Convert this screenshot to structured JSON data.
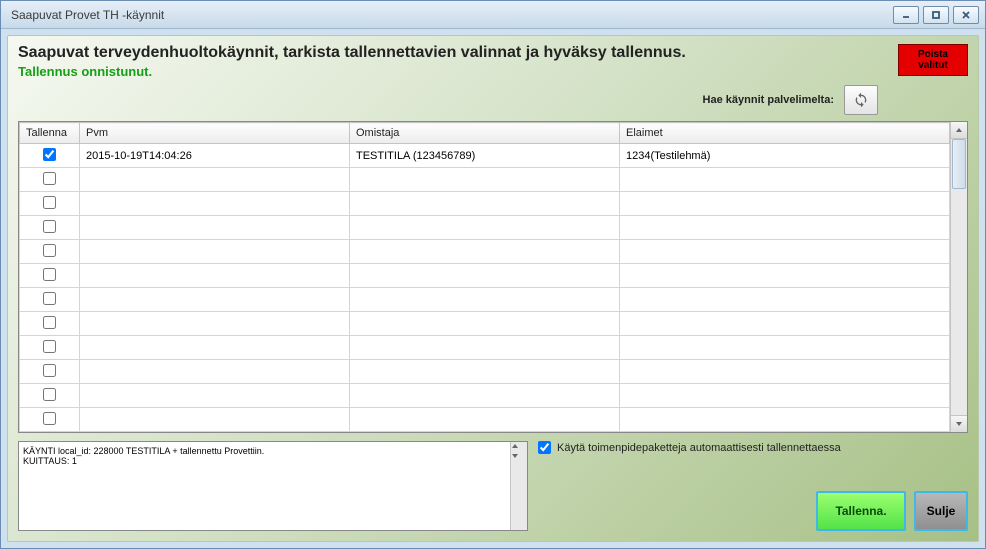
{
  "window": {
    "title": "Saapuvat Provet TH -käynnit"
  },
  "header": {
    "title": "Saapuvat terveydenhuoltokäynnit, tarkista tallennettavien valinnat ja hyväksy tallennus.",
    "status": "Tallennus onnistunut."
  },
  "fetch": {
    "label": "Hae käynnit palvelimelta:"
  },
  "delete_button": {
    "line1": "Poista",
    "line2": "valitut"
  },
  "grid": {
    "headers": {
      "tallenna": "Tallenna",
      "pvm": "Pvm",
      "omistaja": "Omistaja",
      "elaimet": "Elaimet"
    },
    "rows": [
      {
        "checked": true,
        "pvm": "2015-10-19T14:04:26",
        "omistaja": "TESTITILA (123456789)",
        "elaimet": "1234(Testilehmä)"
      },
      {
        "checked": false,
        "pvm": "",
        "omistaja": "",
        "elaimet": ""
      },
      {
        "checked": false,
        "pvm": "",
        "omistaja": "",
        "elaimet": ""
      },
      {
        "checked": false,
        "pvm": "",
        "omistaja": "",
        "elaimet": ""
      },
      {
        "checked": false,
        "pvm": "",
        "omistaja": "",
        "elaimet": ""
      },
      {
        "checked": false,
        "pvm": "",
        "omistaja": "",
        "elaimet": ""
      },
      {
        "checked": false,
        "pvm": "",
        "omistaja": "",
        "elaimet": ""
      },
      {
        "checked": false,
        "pvm": "",
        "omistaja": "",
        "elaimet": ""
      },
      {
        "checked": false,
        "pvm": "",
        "omistaja": "",
        "elaimet": ""
      },
      {
        "checked": false,
        "pvm": "",
        "omistaja": "",
        "elaimet": ""
      },
      {
        "checked": false,
        "pvm": "",
        "omistaja": "",
        "elaimet": ""
      },
      {
        "checked": false,
        "pvm": "",
        "omistaja": "",
        "elaimet": ""
      }
    ]
  },
  "log": {
    "line1": "KÄYNTI local_id: 228000 TESTITILA + tallennettu Provettiin.",
    "line2": "KUITTAUS: 1"
  },
  "auto": {
    "label": "Käytä toimenpidepaketteja automaattisesti tallennettaessa",
    "checked": true
  },
  "buttons": {
    "save": "Tallenna.",
    "close": "Sulje"
  }
}
